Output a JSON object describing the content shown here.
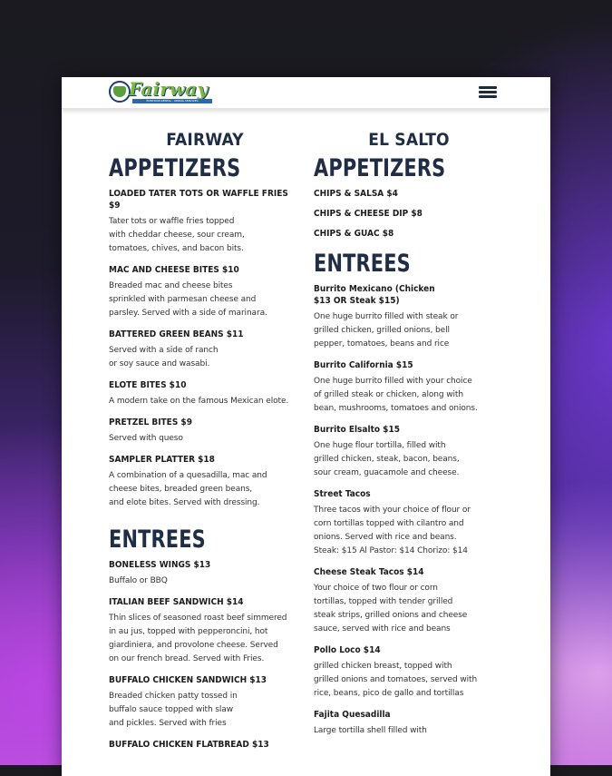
{
  "header": {
    "logo_text": "Fairway",
    "logo_tagline": "PONTOON RENTAL · DINING SERVICES"
  },
  "fairway": {
    "name": "FAIRWAY",
    "appetizers_heading": "APPETIZERS",
    "appetizers": [
      {
        "name": "LOADED TATER TOTS OR WAFFLE FRIES $9",
        "desc": "Tater tots or waffle fries topped\nwith cheddar cheese, sour cream,\ntomatoes, chives, and bacon bits."
      },
      {
        "name": "MAC AND CHEESE BITES $10",
        "desc": "Breaded mac and cheese bites\nsprinkled with parmesan cheese and\nparsley. Served with a side of marinara."
      },
      {
        "name": "BATTERED GREEN BEANS $11",
        "desc": "Served with a side of ranch\nor soy sauce and wasabi."
      },
      {
        "name": "ELOTE BITES $10",
        "desc": "A modern take on the famous Mexican elote."
      },
      {
        "name": "PRETZEL BITES $9",
        "desc": "Served with queso"
      },
      {
        "name": "SAMPLER PLATTER $18",
        "desc": "A combination of a quesadilla, mac and\ncheese bites, breaded green beans,\nand elote bites. Served with dressing."
      }
    ],
    "entrees_heading": "ENTREES",
    "entrees": [
      {
        "name": "BONELESS WINGS $13",
        "desc": "Buffalo or BBQ"
      },
      {
        "name": "ITALIAN BEEF SANDWICH $14",
        "desc": "Thin slices of seasoned roast beef simmered\nin au jus, topped with pepperoncini, hot\ngiardiniera, and provolone cheese. Served\non our french bread. Served with Fries."
      },
      {
        "name": "BUFFALO CHICKEN SANDWICH $13",
        "desc": "Breaded chicken patty tossed in\nbuffalo sauce topped with slaw\nand pickles. Served with fries"
      },
      {
        "name": "BUFFALO CHICKEN FLATBREAD $13",
        "desc": ""
      }
    ]
  },
  "elsalto": {
    "name": "EL SALTO",
    "appetizers_heading": "APPETIZERS",
    "appetizers": [
      {
        "name": "CHIPS & SALSA $4",
        "desc": ""
      },
      {
        "name": "CHIPS & CHEESE DIP $8",
        "desc": ""
      },
      {
        "name": "CHIPS & GUAC $8",
        "desc": ""
      }
    ],
    "entrees_heading": "ENTREES",
    "entrees": [
      {
        "name": "Burrito Mexicano (Chicken\n$13 OR Steak $15)",
        "desc": "One huge burrito filled with steak or\ngrilled chicken, grilled onions, bell\npepper, tomatoes, beans and rice"
      },
      {
        "name": "Burrito California $15",
        "desc": "One huge burrito filled with your choice\nof grilled steak or chicken, along with\nbean, mushrooms, tomatoes and onions."
      },
      {
        "name": "Burrito Elsalto $15",
        "desc": "One huge flour tortilla, filled with\ngrilled chicken, steak, bacon, beans,\nsour cream, guacamole and cheese."
      },
      {
        "name": "Street Tacos",
        "desc": "Three tacos with your choice of flour or\ncorn tortillas topped with cilantro and\nonions. Served with rice and beans.\nSteak: $15 Al Pastor: $14 Chorizo: $14"
      },
      {
        "name": "Cheese Steak Tacos $14",
        "desc": "Your choice of two flour or corn\ntortillas, topped with tender grilled\nsteak strips, grilled onions and cheese\nsauce, served with rice and beans"
      },
      {
        "name": "Pollo Loco $14",
        "desc": "grilled chicken breast, topped with\ngrilled onions and tomatoes, served with\nrice, beans, pico de gallo and tortillas"
      },
      {
        "name": "Fajita Quesadilla",
        "desc": "Large tortilla shell filled with"
      }
    ]
  }
}
